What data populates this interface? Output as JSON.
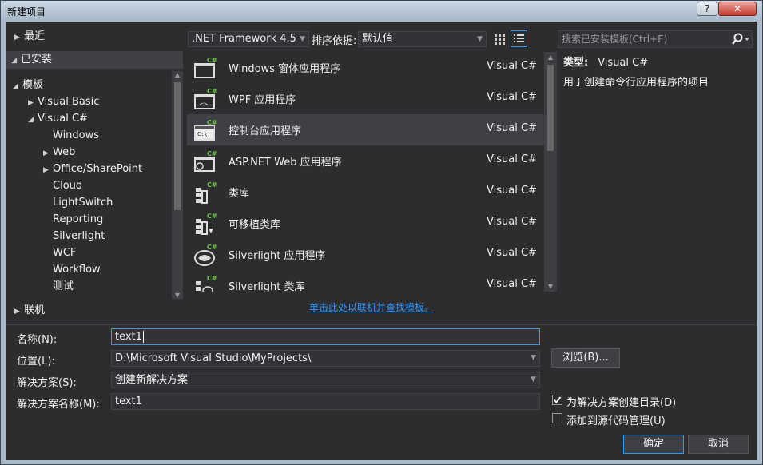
{
  "window": {
    "title": "新建项目",
    "help": "?",
    "close": "✕"
  },
  "left_nav": {
    "recent": "最近",
    "installed": "已安装",
    "tree": [
      {
        "label": "模板"
      },
      {
        "label": "Visual Basic"
      },
      {
        "label": "Visual C#"
      },
      {
        "label": "Windows"
      },
      {
        "label": "Web"
      },
      {
        "label": "Office/SharePoint"
      },
      {
        "label": "Cloud"
      },
      {
        "label": "LightSwitch"
      },
      {
        "label": "Reporting"
      },
      {
        "label": "Silverlight"
      },
      {
        "label": "WCF"
      },
      {
        "label": "Workflow"
      },
      {
        "label": "测试"
      }
    ],
    "online": "联机"
  },
  "toolbar": {
    "framework": ".NET Framework 4.5",
    "sort_label": "排序依据:",
    "sort_value": "默认值",
    "search_placeholder": "搜索已安装模板(Ctrl+E)"
  },
  "templates": [
    {
      "name": "Windows 窗体应用程序",
      "lang": "Visual C#"
    },
    {
      "name": "WPF 应用程序",
      "lang": "Visual C#"
    },
    {
      "name": "控制台应用程序",
      "lang": "Visual C#"
    },
    {
      "name": "ASP.NET Web 应用程序",
      "lang": "Visual C#"
    },
    {
      "name": "类库",
      "lang": "Visual C#"
    },
    {
      "name": "可移植类库",
      "lang": "Visual C#"
    },
    {
      "name": "Silverlight 应用程序",
      "lang": "Visual C#"
    },
    {
      "name": "Silverlight 类库",
      "lang": "Visual C#"
    }
  ],
  "detail": {
    "type_label": "类型:",
    "type_value": "Visual C#",
    "description": "用于创建命令行应用程序的项目"
  },
  "online_link": "单击此处以联机并查找模板。",
  "form": {
    "name_label": "名称(N):",
    "name_value": "text1",
    "location_label": "位置(L):",
    "location_value": "D:\\Microsoft Visual Studio\\MyProjects\\",
    "solution_label": "解决方案(S):",
    "solution_value": "创建新解决方案",
    "solution_name_label": "解决方案名称(M):",
    "solution_name_value": "text1",
    "browse": "浏览(B)...",
    "create_dir": "为解决方案创建目录(D)",
    "add_source": "添加到源代码管理(U)",
    "ok": "确定",
    "cancel": "取消"
  },
  "state": {
    "create_dir_checked": true,
    "add_source_checked": false,
    "selected_template": "控制台应用程序"
  }
}
